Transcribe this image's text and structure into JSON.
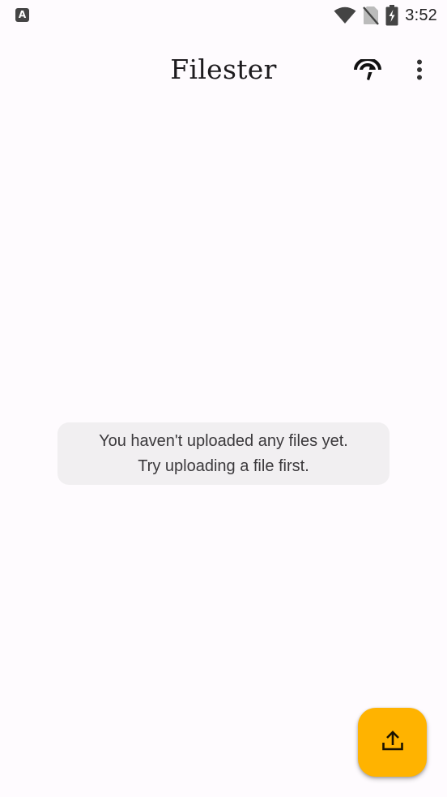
{
  "status_bar": {
    "left_icon_letter": "A",
    "time": "3:52",
    "icons": [
      "wifi-icon",
      "no-sim-icon",
      "battery-charging-icon"
    ]
  },
  "app_bar": {
    "title": "Filester",
    "actions": [
      "speed-icon",
      "more-vert-icon"
    ]
  },
  "empty_state": {
    "line1": "You haven't uploaded any files yet.",
    "line2": "Try uploading a file first."
  },
  "fab": {
    "icon": "upload-icon"
  },
  "colors": {
    "background": "#fefbfe",
    "fab": "#ffb300",
    "card": "#f1eff1",
    "text": "#1d1b1e"
  }
}
